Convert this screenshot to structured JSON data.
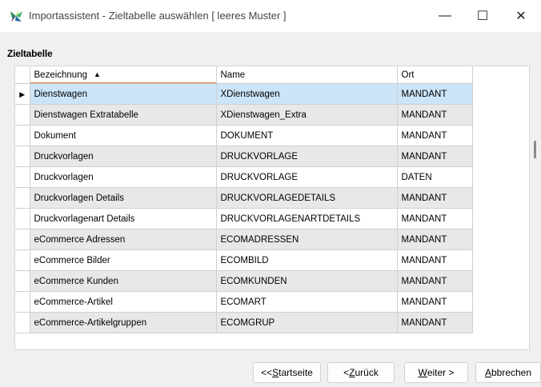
{
  "window": {
    "title": "Importassistent - Zieltabelle auswählen [ leeres Muster ]",
    "minimize_glyph": "—",
    "maximize_glyph": "☐",
    "close_glyph": "✕"
  },
  "section": {
    "title": "Zieltabelle"
  },
  "grid": {
    "columns": [
      "Bezeichnung",
      "Name",
      "Ort"
    ],
    "sort_column": "Bezeichnung",
    "sort_direction": "ascending",
    "selected_row": 0,
    "rows": [
      {
        "bezeichnung": "Dienstwagen",
        "name": "XDienstwagen",
        "ort": "MANDANT"
      },
      {
        "bezeichnung": "Dienstwagen Extratabelle",
        "name": "XDienstwagen_Extra",
        "ort": "MANDANT"
      },
      {
        "bezeichnung": "Dokument",
        "name": "DOKUMENT",
        "ort": "MANDANT"
      },
      {
        "bezeichnung": "Druckvorlagen",
        "name": "DRUCKVORLAGE",
        "ort": "MANDANT"
      },
      {
        "bezeichnung": "Druckvorlagen",
        "name": "DRUCKVORLAGE",
        "ort": "DATEN"
      },
      {
        "bezeichnung": "Druckvorlagen Details",
        "name": "DRUCKVORLAGEDETAILS",
        "ort": "MANDANT"
      },
      {
        "bezeichnung": "Druckvorlagenart Details",
        "name": "DRUCKVORLAGENARTDETAILS",
        "ort": "MANDANT"
      },
      {
        "bezeichnung": "eCommerce Adressen",
        "name": "ECOMADRESSEN",
        "ort": "MANDANT"
      },
      {
        "bezeichnung": "eCommerce Bilder",
        "name": "ECOMBILD",
        "ort": "MANDANT"
      },
      {
        "bezeichnung": "eCommerce Kunden",
        "name": "ECOMKUNDEN",
        "ort": "MANDANT"
      },
      {
        "bezeichnung": "eCommerce-Artikel",
        "name": "ECOMART",
        "ort": "MANDANT"
      },
      {
        "bezeichnung": "eCommerce-Artikelgruppen",
        "name": "ECOMGRUP",
        "ort": "MANDANT"
      }
    ]
  },
  "buttons": {
    "start": {
      "prefix": "<< ",
      "mnemonic": "S",
      "rest": "tartseite"
    },
    "back": {
      "prefix": "< ",
      "mnemonic": "Z",
      "rest": "urück"
    },
    "next": {
      "prefix": "",
      "mnemonic": "W",
      "rest": "eiter >"
    },
    "cancel": {
      "prefix": "",
      "mnemonic": "A",
      "rest": "bbrechen"
    }
  },
  "colors": {
    "selected_row": "#cce4f7",
    "alt_row": "#e8e8e8",
    "sort_accent": "#e8833a"
  }
}
